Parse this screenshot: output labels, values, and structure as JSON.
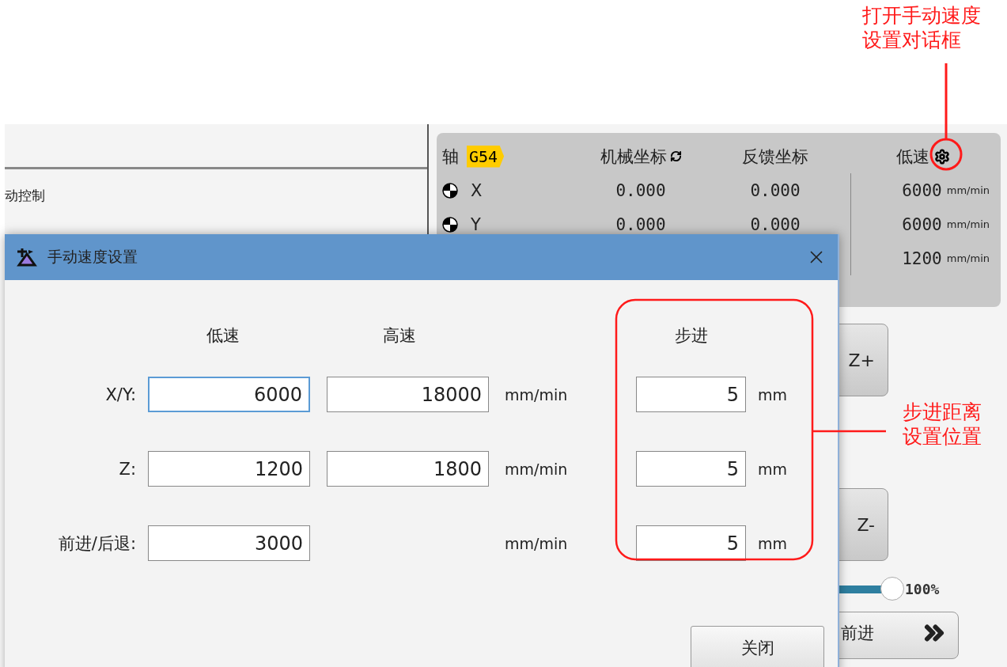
{
  "left_panel": {
    "label": "动控制"
  },
  "axis_card": {
    "header": {
      "axis": "轴",
      "coord_system": "G54",
      "machine": "机械坐标",
      "feedback": "反馈坐标",
      "speed": "低速"
    },
    "rows": [
      {
        "axis": "X",
        "machine": "0.000",
        "feedback": "0.000",
        "speed": "6000",
        "unit": "mm/min"
      },
      {
        "axis": "Y",
        "machine": "0.000",
        "feedback": "0.000",
        "speed": "6000",
        "unit": "mm/min"
      },
      {
        "speed": "1200",
        "unit": "mm/min"
      }
    ]
  },
  "jog_buttons": [
    "Z+",
    "Z-"
  ],
  "override": {
    "level": 1,
    "reading": "100%"
  },
  "forward_button": "前进",
  "dialog": {
    "title": "手动速度设置",
    "headers": {
      "low": "低速",
      "high": "高速",
      "step": "步进"
    },
    "rows": [
      {
        "label": "X/Y:",
        "low": {
          "value": "6000",
          "focused": true
        },
        "high": {
          "value": "18000",
          "focused": false
        },
        "unit": "mm/min",
        "step": {
          "value": "5",
          "focused": false
        },
        "step_unit": "mm"
      },
      {
        "label": "Z:",
        "low": {
          "value": "1200",
          "focused": false
        },
        "high": {
          "value": "1800",
          "focused": false
        },
        "unit": "mm/min",
        "step": {
          "value": "5",
          "focused": false
        },
        "step_unit": "mm"
      },
      {
        "label": "前进/后退:",
        "low": {
          "value": "3000",
          "focused": false
        },
        "unit": "mm/min",
        "step": {
          "value": "5",
          "focused": false
        },
        "step_unit": "mm"
      }
    ],
    "close_button": "关闭"
  },
  "annotations": [
    {
      "kind": "gear",
      "text": "打开手动速度设置对话框"
    },
    {
      "kind": "step",
      "text": "步进距离设置位置"
    }
  ]
}
